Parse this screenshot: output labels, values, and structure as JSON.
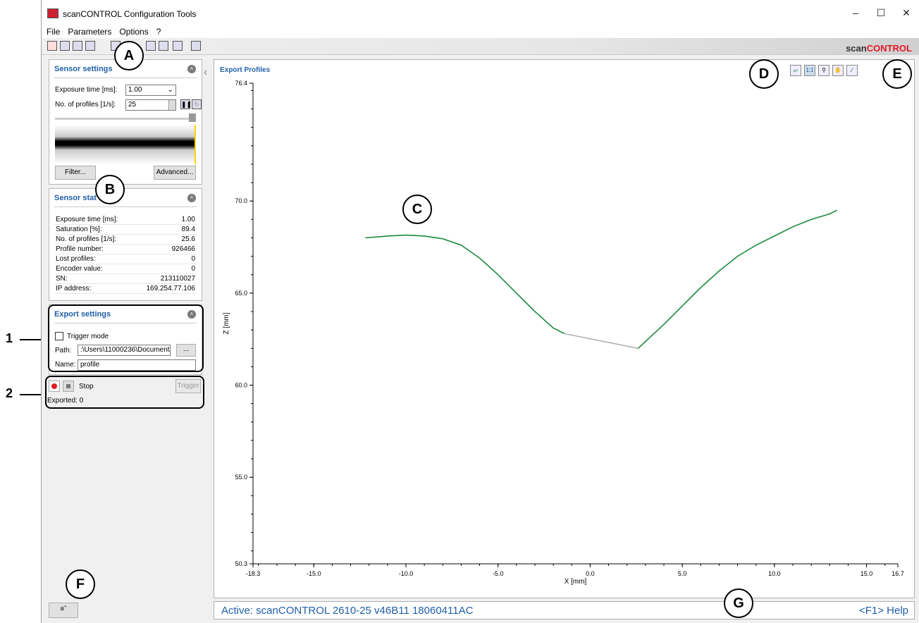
{
  "window": {
    "title": "scanCONTROL Configuration Tools"
  },
  "menu": [
    "File",
    "Parameters",
    "Options",
    "?"
  ],
  "brand": {
    "part1": "scan",
    "part2": "CONTROL",
    "accent": "#e31b23"
  },
  "sensor_settings": {
    "header": "Sensor settings",
    "exposure_label": "Exposure time [ms]:",
    "exposure_value": "1.00",
    "profiles_label": "No. of profiles [1/s]:",
    "profiles_value": "25",
    "filter_button": "Filter...",
    "advanced_button": "Advanced..."
  },
  "sensor_status": {
    "header": "Sensor stat",
    "rows": [
      {
        "k": "Exposure time [ms]:",
        "v": "1.00"
      },
      {
        "k": "Saturation [%]:",
        "v": "89.4"
      },
      {
        "k": "No. of profiles [1/s]:",
        "v": "25.6"
      },
      {
        "k": "Profile number:",
        "v": "926466"
      },
      {
        "k": "Lost profiles:",
        "v": "0"
      },
      {
        "k": "Encoder value:",
        "v": "0"
      },
      {
        "k": "SN:",
        "v": "213110027"
      },
      {
        "k": "IP address:",
        "v": "169.254.77.106"
      }
    ]
  },
  "export_settings": {
    "header": "Export settings",
    "trigger_mode": "Trigger mode",
    "path_label": "Path:",
    "path_value": ":\\Users\\11000236\\Documents",
    "browse_button": "...",
    "name_label": "Name:",
    "name_value": "profile"
  },
  "export_control": {
    "stop_label": "Stop",
    "trigger_button": "Trigger",
    "exported": "Exported: 0"
  },
  "plot": {
    "title": "Export Profiles",
    "xlabel": "X [mm]",
    "ylabel": "Z [mm]",
    "yticks": [
      "76.4",
      "70.0",
      "65.0",
      "60.0",
      "55.0",
      "50.3"
    ],
    "xticks": [
      "-18.3",
      "-15.0",
      "-10.0",
      "-5.0",
      "0.0",
      "5.0",
      "10.0",
      "15.0",
      "16.7"
    ],
    "zoom_label": "1:1"
  },
  "statusbar": {
    "active": "Active: scanCONTROL 2610-25 v46B11  18060411AC",
    "help": "<F1> Help"
  },
  "callouts": {
    "A": "A",
    "B": "B",
    "C": "C",
    "D": "D",
    "E": "E",
    "F": "F",
    "G": "G",
    "one": "1",
    "two": "2"
  },
  "chart_data": {
    "type": "line",
    "title": "Export Profiles",
    "xlabel": "X [mm]",
    "ylabel": "Z [mm]",
    "xlim": [
      -18.3,
      16.7
    ],
    "ylim": [
      50.3,
      76.4
    ],
    "grid": false,
    "series": [
      {
        "color": "#1a8a3c",
        "x": [
          -12.2,
          -11.0,
          -10.0,
          -9.0,
          -8.0,
          -7.0,
          -6.0,
          -5.0,
          -4.0,
          -3.0,
          -2.0,
          -1.4
        ],
        "y": [
          68.0,
          68.1,
          68.15,
          68.1,
          67.95,
          67.6,
          66.9,
          66.0,
          65.0,
          64.0,
          63.1,
          62.8
        ]
      },
      {
        "color": "#b0b0b0",
        "x": [
          -1.4,
          2.6
        ],
        "y": [
          62.8,
          62.0
        ]
      },
      {
        "color": "#1a8a3c",
        "x": [
          2.6,
          4.0,
          5.0,
          6.0,
          7.0,
          8.0,
          9.0,
          10.0,
          11.0,
          12.0,
          13.0,
          13.4
        ],
        "y": [
          62.0,
          63.3,
          64.3,
          65.3,
          66.2,
          67.0,
          67.6,
          68.1,
          68.6,
          69.0,
          69.3,
          69.5
        ]
      }
    ]
  }
}
